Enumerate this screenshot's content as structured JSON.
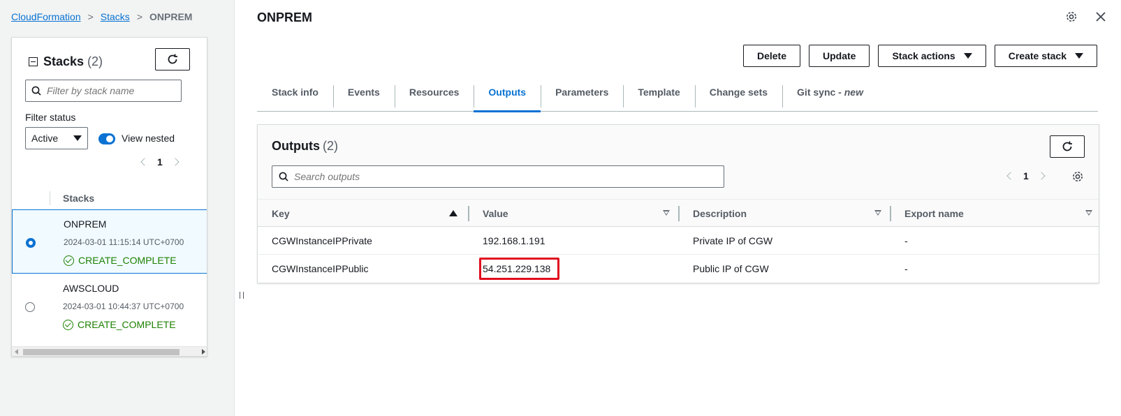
{
  "breadcrumbs": [
    "CloudFormation",
    "Stacks",
    "ONPREM"
  ],
  "sidebar": {
    "title": "Stacks",
    "count": "(2)",
    "filter_placeholder": "Filter by stack name",
    "filter_status_label": "Filter status",
    "filter_status_value": "Active",
    "view_nested_label": "View nested",
    "view_nested_on": true,
    "page": "1",
    "column_header": "Stacks",
    "stacks": [
      {
        "name": "ONPREM",
        "date": "2024-03-01 11:15:14 UTC+0700",
        "status": "CREATE_COMPLETE",
        "selected": true
      },
      {
        "name": "AWSCLOUD",
        "date": "2024-03-01 10:44:37 UTC+0700",
        "status": "CREATE_COMPLETE",
        "selected": false
      }
    ]
  },
  "main": {
    "title": "ONPREM",
    "actions": [
      "Delete",
      "Update",
      "Stack actions",
      "Create stack"
    ],
    "tabs": [
      {
        "label": "Stack info"
      },
      {
        "label": "Events"
      },
      {
        "label": "Resources"
      },
      {
        "label": "Outputs",
        "active": true
      },
      {
        "label": "Parameters"
      },
      {
        "label": "Template"
      },
      {
        "label": "Change sets"
      },
      {
        "label": "Git sync - ",
        "suffix": "new"
      }
    ],
    "outputs": {
      "title": "Outputs",
      "count": "(2)",
      "search_placeholder": "Search outputs",
      "page": "1",
      "columns": [
        "Key",
        "Value",
        "Description",
        "Export name"
      ],
      "rows": [
        [
          "CGWInstanceIPPrivate",
          "192.168.1.191",
          "Private IP of CGW",
          "-"
        ],
        [
          "CGWInstanceIPPublic",
          "54.251.229.138",
          "Public IP of CGW",
          "-"
        ]
      ],
      "highlighted_cell": "54.251.229.138"
    }
  },
  "colors": {
    "link": "#0972d3",
    "success": "#1d8102",
    "highlight": "#e10d1e"
  }
}
